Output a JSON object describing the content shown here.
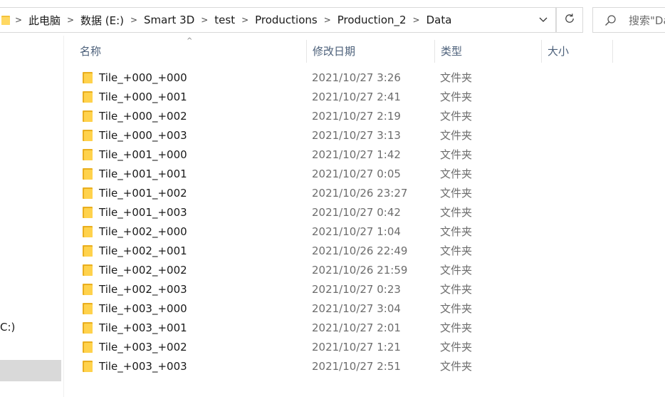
{
  "address_bar": {
    "breadcrumbs": [
      "此电脑",
      "数据 (E:)",
      "Smart 3D",
      "test",
      "Productions",
      "Production_2",
      "Data"
    ],
    "separator": ">",
    "dropdown_icon": "chevron-down-icon"
  },
  "refresh": {
    "icon": "refresh-icon"
  },
  "search": {
    "placeholder": "搜索\"Da",
    "icon": "search-icon"
  },
  "nav_pane": {
    "partial_item_label": "C:)"
  },
  "columns": {
    "name": "名称",
    "date": "修改日期",
    "type": "类型",
    "size": "大小",
    "sort_indicator": "^"
  },
  "files": [
    {
      "name": "Tile_+000_+000",
      "date": "2021/10/27 3:26",
      "type": "文件夹",
      "size": ""
    },
    {
      "name": "Tile_+000_+001",
      "date": "2021/10/27 2:41",
      "type": "文件夹",
      "size": ""
    },
    {
      "name": "Tile_+000_+002",
      "date": "2021/10/27 2:19",
      "type": "文件夹",
      "size": ""
    },
    {
      "name": "Tile_+000_+003",
      "date": "2021/10/27 3:13",
      "type": "文件夹",
      "size": ""
    },
    {
      "name": "Tile_+001_+000",
      "date": "2021/10/27 1:42",
      "type": "文件夹",
      "size": ""
    },
    {
      "name": "Tile_+001_+001",
      "date": "2021/10/27 0:05",
      "type": "文件夹",
      "size": ""
    },
    {
      "name": "Tile_+001_+002",
      "date": "2021/10/26 23:27",
      "type": "文件夹",
      "size": ""
    },
    {
      "name": "Tile_+001_+003",
      "date": "2021/10/27 0:42",
      "type": "文件夹",
      "size": ""
    },
    {
      "name": "Tile_+002_+000",
      "date": "2021/10/27 1:04",
      "type": "文件夹",
      "size": ""
    },
    {
      "name": "Tile_+002_+001",
      "date": "2021/10/26 22:49",
      "type": "文件夹",
      "size": ""
    },
    {
      "name": "Tile_+002_+002",
      "date": "2021/10/26 21:59",
      "type": "文件夹",
      "size": ""
    },
    {
      "name": "Tile_+002_+003",
      "date": "2021/10/27 0:23",
      "type": "文件夹",
      "size": ""
    },
    {
      "name": "Tile_+003_+000",
      "date": "2021/10/27 3:04",
      "type": "文件夹",
      "size": ""
    },
    {
      "name": "Tile_+003_+001",
      "date": "2021/10/27 2:01",
      "type": "文件夹",
      "size": ""
    },
    {
      "name": "Tile_+003_+002",
      "date": "2021/10/27 1:21",
      "type": "文件夹",
      "size": ""
    },
    {
      "name": "Tile_+003_+003",
      "date": "2021/10/27 2:51",
      "type": "文件夹",
      "size": ""
    }
  ],
  "colors": {
    "folder": "#ffd24c",
    "folder_back": "#e9ae1f",
    "header_text": "#4c607a",
    "secondary_text": "#6d6d6d",
    "nav_selected": "#d9d9d9"
  }
}
